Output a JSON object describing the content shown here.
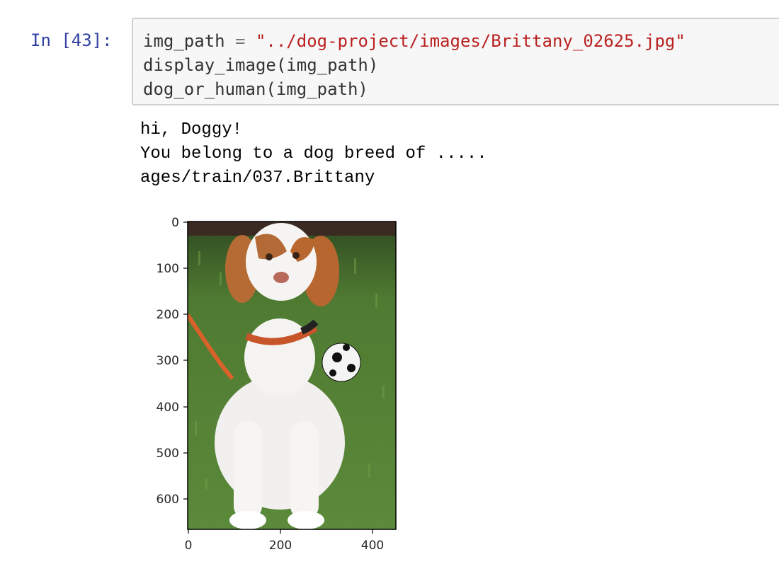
{
  "cell": {
    "prompt": "In [43]:",
    "code": {
      "line1_var": "img_path",
      "line1_op": "=",
      "line1_str": "\"../dog-project/images/Brittany_02625.jpg\"",
      "line2": "display_image(img_path)",
      "line3": "dog_or_human(img_path)"
    },
    "output": {
      "line1": "hi, Doggy!",
      "line2": "You belong to a dog breed of .....",
      "line3": "ages/train/037.Brittany"
    }
  },
  "chart_data": {
    "type": "image",
    "image_subject": "Brittany puppy sitting on grass with an orange leash and a soccer ball",
    "xlim": [
      0,
      450
    ],
    "ylim": [
      670,
      0
    ],
    "x_ticks": [
      "0",
      "200",
      "400"
    ],
    "y_ticks": [
      "0",
      "100",
      "200",
      "300",
      "400",
      "500",
      "600"
    ]
  },
  "colors": {
    "prompt": "#303f9f",
    "string": "#ba2121",
    "input_bg": "#f7f7f7",
    "input_border": "#cfcfcf"
  }
}
